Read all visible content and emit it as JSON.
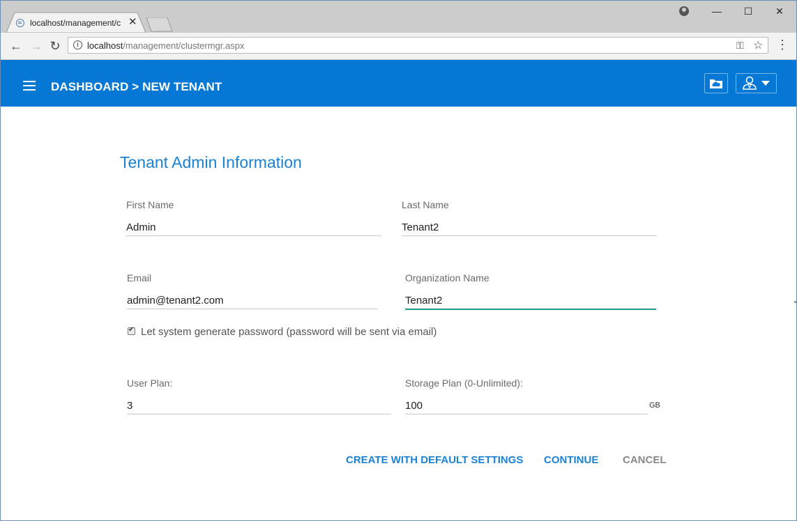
{
  "browser": {
    "tab_title": "localhost/management/c",
    "url_host": "localhost",
    "url_path": "/management/clustermgr.aspx",
    "window_controls": {
      "minimize": "—",
      "maximize": "☐",
      "close": "✕"
    }
  },
  "header": {
    "breadcrumb": "DASHBOARD > NEW TENANT",
    "bg_color": "#0478d4"
  },
  "form": {
    "title": "Tenant Admin Information",
    "first_name": {
      "label": "First Name",
      "value": "Admin"
    },
    "last_name": {
      "label": "Last Name",
      "value": "Tenant2"
    },
    "email": {
      "label": "Email",
      "value": "admin@tenant2.com"
    },
    "organization": {
      "label": "Organization Name",
      "value": "Tenant2"
    },
    "generate_password": {
      "label": "Let system generate password (password will be sent via email)",
      "checked": true
    },
    "user_plan": {
      "label": "User Plan:",
      "value": "3"
    },
    "storage_plan": {
      "label": "Storage Plan (0-Unlimited):",
      "value": "100",
      "unit": "GB"
    }
  },
  "actions": {
    "create_default": "CREATE WITH DEFAULT SETTINGS",
    "continue": "CONTINUE",
    "cancel": "CANCEL"
  },
  "colors": {
    "accent": "#1a82d4",
    "focus": "#1b9c8a",
    "cancel": "#888888"
  }
}
